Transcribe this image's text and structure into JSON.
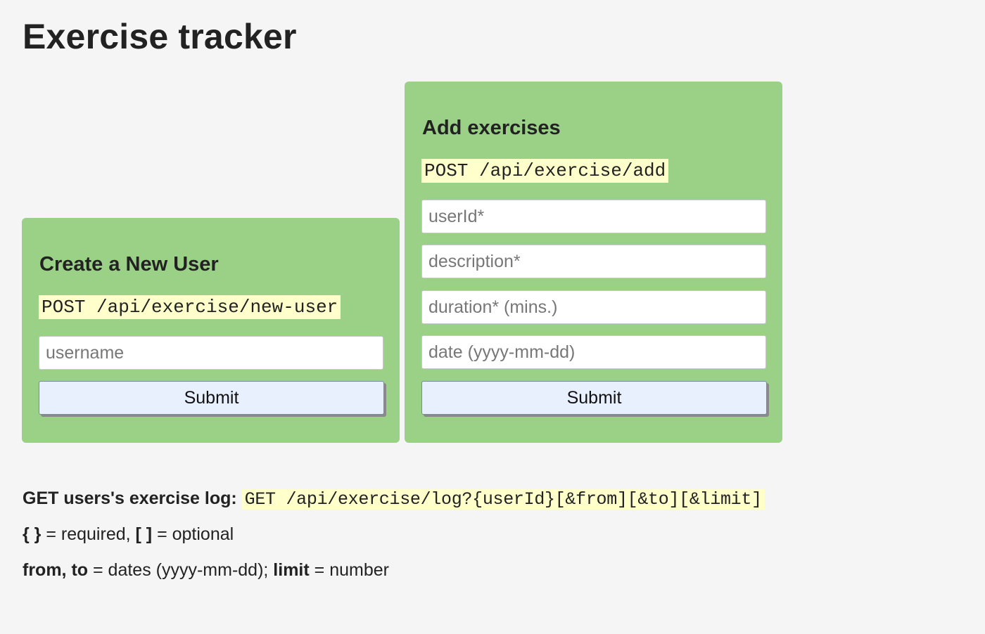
{
  "page": {
    "title": "Exercise tracker"
  },
  "new_user": {
    "heading": "Create a New User",
    "endpoint": "POST /api/exercise/new-user",
    "username_placeholder": "username",
    "submit_label": "Submit"
  },
  "add_exercise": {
    "heading": "Add exercises",
    "endpoint": "POST /api/exercise/add",
    "userid_placeholder": "userId*",
    "description_placeholder": "description*",
    "duration_placeholder": "duration* (mins.)",
    "date_placeholder": "date (yyyy-mm-dd)",
    "submit_label": "Submit"
  },
  "log": {
    "label": "GET users's exercise log:",
    "endpoint": "GET /api/exercise/log?{userId}[&from][&to][&limit]"
  },
  "notes": {
    "required_symbol": "{ }",
    "required_text": " = required, ",
    "optional_symbol": "[ ]",
    "optional_text": " = optional",
    "dates_keys": "from, to",
    "dates_text": " = dates (yyyy-mm-dd); ",
    "limit_key": "limit",
    "limit_text": " = number"
  },
  "colors": {
    "panel_bg": "#9bd187",
    "code_bg": "#ffffcc",
    "button_bg": "#e8f0fe",
    "page_bg": "#f5f5f5"
  }
}
